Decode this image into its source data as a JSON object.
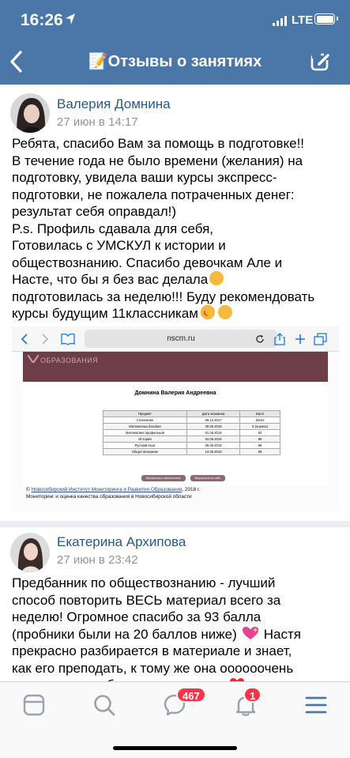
{
  "status_bar": {
    "time": "16:26",
    "network": "LTE"
  },
  "header": {
    "title": "📝Отзывы о занятиях"
  },
  "posts": [
    {
      "author": "Валерия Домнина",
      "date": "27 июн в 14:17",
      "lines": [
        "Ребята, спасибо Вам за помощь в подготовке!!",
        "В течение года не было времени (желания) на",
        "подготовку, увидела ваши курсы экспресс-",
        "подготовки, не пожалела потраченных денег:",
        "результат себя оправдал!)",
        "P.s. Профиль сдавала для себя,",
        "Готовилась с УМСКУЛ к истории и",
        "обществознанию. Спасибо девочкам Але и",
        "Насте, что бы я без вас делала",
        "подготовилась за неделю!!! Буду рекомендовать",
        "курсы будущим 11классникам"
      ],
      "attachment": {
        "browser_url": "nscm.ru",
        "banner_text": "ОБРАЗОВАНИЯ",
        "student_name": "Домнина Валерия Андреевна",
        "table_headers": [
          "Предмет",
          "Дата экзамена",
          "Балл"
        ],
        "table_rows": [
          [
            "Сочинение",
            "06.12.2017",
            "Зачет"
          ],
          [
            "Математика базовая",
            "30.05.2018",
            "5 (оценка)"
          ],
          [
            "Математика профильная",
            "01.06.2018",
            "82"
          ],
          [
            "История",
            "04.06.2018",
            "86"
          ],
          [
            "Русский язык",
            "06.06.2018",
            "96"
          ],
          [
            "Обществознание",
            "14.06.2018",
            "95"
          ]
        ],
        "buttons": [
          "Вернуться к заполнению",
          "Вернуться на сайт"
        ],
        "footer_prefix": "© ",
        "footer_link": "Новосибирский Институт Мониторинга и Развития Образования",
        "footer_suffix": ", 2018 г.",
        "footer_line2": "Мониторинг и оценка качества образования в Новосибирской области"
      }
    },
    {
      "author": "Екатерина Архипова",
      "date": "27 июн в 23:42",
      "lines": [
        "Предбанник по обществознанию - лучший",
        "способ повторить ВЕСЬ материал всего за",
        "неделю! Огромное спасибо за 93 балла",
        "(пробники были на 20 баллов ниже)",
        "прекрасно разбирается в материале и знает,",
        "как его преподать, к тому же она оооооочень",
        "приятная и вообще самая лучшая"
      ],
      "line4_suffix": "Настя"
    }
  ],
  "tabbar": {
    "messages_badge": "467",
    "notifications_badge": "1"
  },
  "colors": {
    "brand": "#4a76a8",
    "link": "#2a5885",
    "badge": "#ff3347",
    "tab_active": "#4a76a8",
    "tab_inactive": "#99a2ad"
  }
}
